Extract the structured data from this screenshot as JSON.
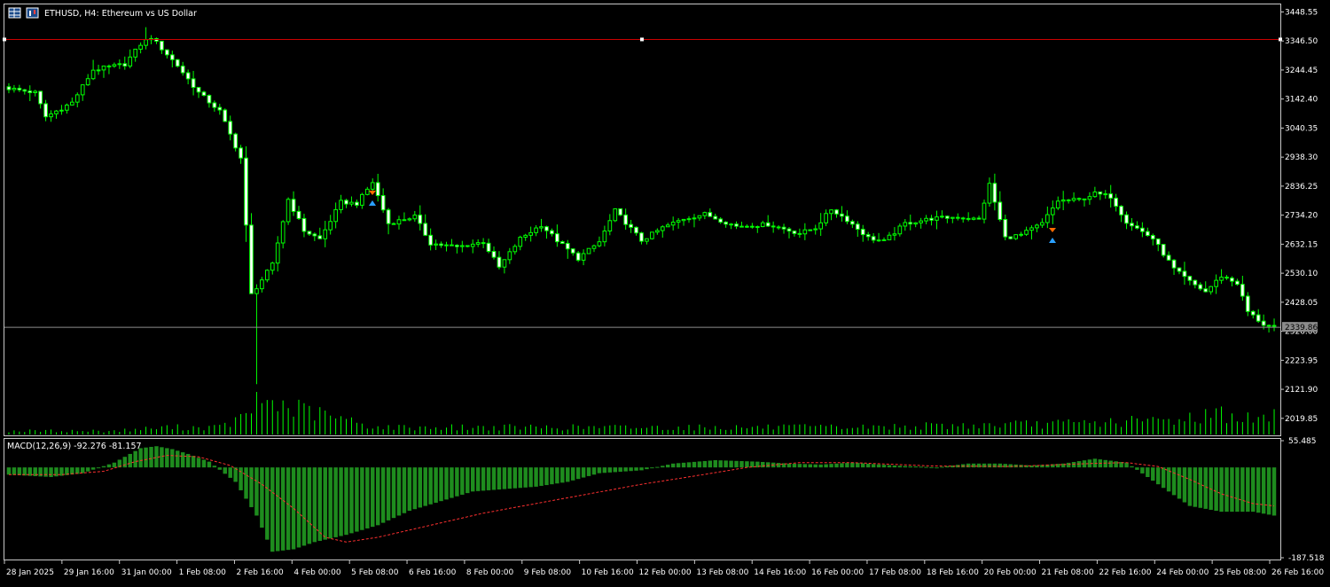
{
  "window": {
    "symbol_label": "ETHUSD, H4:  Ethereum vs US Dollar",
    "indicator_label": "MACD(12,26,9) -92.276 -81.157",
    "current_price_label": "2339.86"
  },
  "colors": {
    "background": "#000000",
    "frame": "#c8c8c8",
    "candle_bull": "#00ff00",
    "candle_body_bull": "#000000",
    "candle_body_bear": "#ffffff",
    "wick": "#00ff00",
    "volume": "#00ff00",
    "macd_hist": "#1e8c1e",
    "macd_signal": "#ff3030",
    "hline_red": "#cc0000",
    "price_line": "#8c8c8c",
    "price_tag_bg": "#8c8c8c",
    "axis_text": "#ffffff"
  },
  "chart_data": [
    {
      "type": "candlestick",
      "title": "ETHUSD, H4:  Ethereum vs US Dollar",
      "ylim": [
        1960,
        3475
      ],
      "y_ticks": [
        "3448.55",
        "3346.50",
        "3244.45",
        "3142.40",
        "3040.35",
        "2938.30",
        "2836.25",
        "2734.20",
        "2632.15",
        "2530.10",
        "2428.05",
        "2326.00",
        "2223.95",
        "2121.90",
        "2019.85"
      ],
      "x_tick_labels": [
        "28 Jan 2025",
        "29 Jan 16:00",
        "31 Jan 00:00",
        "1 Feb 08:00",
        "2 Feb 16:00",
        "4 Feb 00:00",
        "5 Feb 08:00",
        "6 Feb 16:00",
        "8 Feb 00:00",
        "9 Feb 08:00",
        "10 Feb 16:00",
        "12 Feb 00:00",
        "13 Feb 08:00",
        "14 Feb 16:00",
        "16 Feb 00:00",
        "17 Feb 08:00",
        "18 Feb 16:00",
        "20 Feb 00:00",
        "21 Feb 08:00",
        "22 Feb 16:00",
        "24 Feb 00:00",
        "25 Feb 08:00",
        "26 Feb 16:00"
      ],
      "horizontal_line": 3352,
      "current_price": 2339.86,
      "close_anchors": [
        [
          0,
          3180
        ],
        [
          5,
          3165
        ],
        [
          7,
          3080
        ],
        [
          12,
          3130
        ],
        [
          16,
          3245
        ],
        [
          22,
          3265
        ],
        [
          25,
          3335
        ],
        [
          27,
          3360
        ],
        [
          29,
          3320
        ],
        [
          32,
          3260
        ],
        [
          36,
          3165
        ],
        [
          40,
          3100
        ],
        [
          44,
          2935
        ],
        [
          46,
          2455
        ],
        [
          50,
          2560
        ],
        [
          53,
          2790
        ],
        [
          56,
          2680
        ],
        [
          59,
          2650
        ],
        [
          63,
          2780
        ],
        [
          66,
          2775
        ],
        [
          69,
          2850
        ],
        [
          72,
          2705
        ],
        [
          77,
          2730
        ],
        [
          80,
          2635
        ],
        [
          85,
          2622
        ],
        [
          90,
          2640
        ],
        [
          93,
          2550
        ],
        [
          97,
          2652
        ],
        [
          101,
          2700
        ],
        [
          104,
          2645
        ],
        [
          108,
          2582
        ],
        [
          112,
          2640
        ],
        [
          115,
          2750
        ],
        [
          120,
          2645
        ],
        [
          124,
          2690
        ],
        [
          128,
          2722
        ],
        [
          132,
          2738
        ],
        [
          138,
          2695
        ],
        [
          144,
          2702
        ],
        [
          150,
          2670
        ],
        [
          153,
          2690
        ],
        [
          156,
          2755
        ],
        [
          159,
          2718
        ],
        [
          163,
          2655
        ],
        [
          166,
          2642
        ],
        [
          170,
          2705
        ],
        [
          175,
          2722
        ],
        [
          180,
          2728
        ],
        [
          184,
          2718
        ],
        [
          186,
          2842
        ],
        [
          189,
          2655
        ],
        [
          192,
          2665
        ],
        [
          196,
          2705
        ],
        [
          199,
          2785
        ],
        [
          203,
          2788
        ],
        [
          206,
          2810
        ],
        [
          209,
          2800
        ],
        [
          212,
          2712
        ],
        [
          217,
          2652
        ],
        [
          221,
          2545
        ],
        [
          224,
          2500
        ],
        [
          227,
          2465
        ],
        [
          230,
          2520
        ],
        [
          233,
          2495
        ],
        [
          235,
          2395
        ],
        [
          238,
          2350
        ],
        [
          240,
          2340
        ]
      ],
      "volume_anchors": [
        [
          0,
          0.1
        ],
        [
          20,
          0.1
        ],
        [
          30,
          0.2
        ],
        [
          40,
          0.2
        ],
        [
          45,
          0.5
        ],
        [
          47,
          1.0
        ],
        [
          52,
          0.8
        ],
        [
          58,
          0.6
        ],
        [
          64,
          0.4
        ],
        [
          70,
          0.2
        ],
        [
          90,
          0.2
        ],
        [
          120,
          0.2
        ],
        [
          160,
          0.2
        ],
        [
          200,
          0.3
        ],
        [
          220,
          0.4
        ],
        [
          230,
          0.6
        ],
        [
          236,
          0.4
        ],
        [
          240,
          0.5
        ]
      ]
    },
    {
      "type": "macd",
      "title": "MACD(12,26,9) -92.276 -81.157",
      "params": [
        12,
        26,
        9
      ],
      "macd_last": -92.276,
      "signal_last": -81.157,
      "ylim": [
        -187.518,
        55.485
      ],
      "y_ticks": [
        "55.485",
        "-187.518"
      ],
      "zero_level": 0,
      "macd_anchors": [
        [
          0,
          -15
        ],
        [
          8,
          -20
        ],
        [
          14,
          -12
        ],
        [
          20,
          10
        ],
        [
          25,
          40
        ],
        [
          28,
          44
        ],
        [
          31,
          38
        ],
        [
          34,
          28
        ],
        [
          38,
          12
        ],
        [
          43,
          -30
        ],
        [
          47,
          -100
        ],
        [
          50,
          -175
        ],
        [
          54,
          -170
        ],
        [
          58,
          -155
        ],
        [
          64,
          -140
        ],
        [
          70,
          -120
        ],
        [
          76,
          -90
        ],
        [
          82,
          -70
        ],
        [
          88,
          -50
        ],
        [
          94,
          -45
        ],
        [
          100,
          -40
        ],
        [
          106,
          -30
        ],
        [
          112,
          -12
        ],
        [
          120,
          -6
        ],
        [
          126,
          8
        ],
        [
          134,
          15
        ],
        [
          142,
          12
        ],
        [
          148,
          8
        ],
        [
          154,
          6
        ],
        [
          160,
          10
        ],
        [
          168,
          4
        ],
        [
          176,
          0
        ],
        [
          182,
          8
        ],
        [
          188,
          8
        ],
        [
          194,
          4
        ],
        [
          200,
          8
        ],
        [
          206,
          18
        ],
        [
          212,
          10
        ],
        [
          216,
          -20
        ],
        [
          220,
          -50
        ],
        [
          224,
          -80
        ],
        [
          230,
          -92
        ],
        [
          236,
          -92
        ],
        [
          240,
          -100
        ]
      ],
      "signal_anchors": [
        [
          0,
          -15
        ],
        [
          10,
          -15
        ],
        [
          18,
          -8
        ],
        [
          24,
          12
        ],
        [
          30,
          25
        ],
        [
          36,
          22
        ],
        [
          42,
          4
        ],
        [
          48,
          -35
        ],
        [
          54,
          -85
        ],
        [
          60,
          -145
        ],
        [
          64,
          -155
        ],
        [
          70,
          -145
        ],
        [
          80,
          -120
        ],
        [
          90,
          -95
        ],
        [
          100,
          -75
        ],
        [
          110,
          -55
        ],
        [
          120,
          -35
        ],
        [
          130,
          -18
        ],
        [
          140,
          0
        ],
        [
          150,
          10
        ],
        [
          160,
          10
        ],
        [
          175,
          3
        ],
        [
          190,
          2
        ],
        [
          205,
          8
        ],
        [
          212,
          10
        ],
        [
          218,
          2
        ],
        [
          224,
          -25
        ],
        [
          230,
          -55
        ],
        [
          236,
          -75
        ],
        [
          240,
          -80
        ]
      ]
    }
  ]
}
